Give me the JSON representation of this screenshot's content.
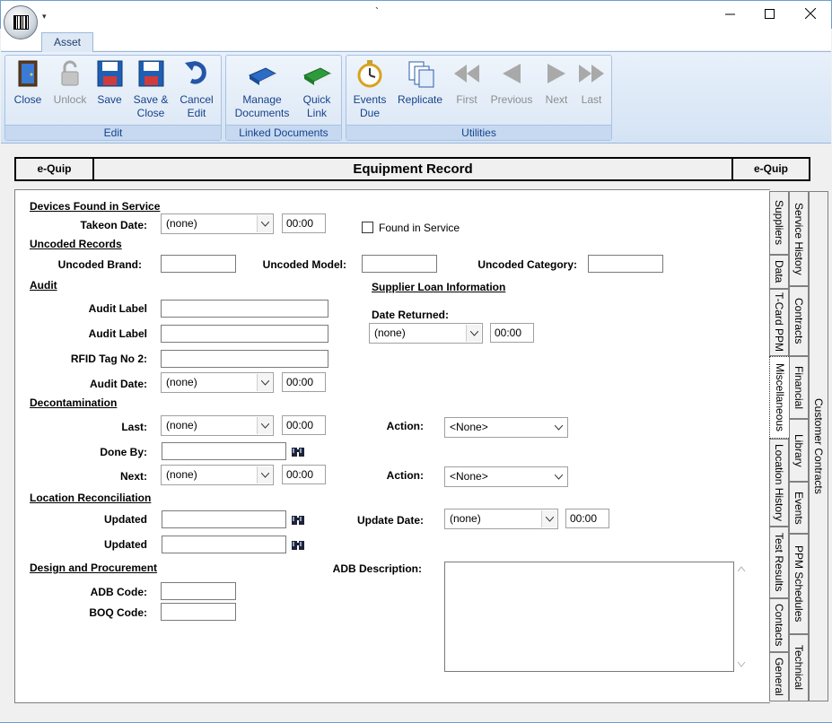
{
  "window": {
    "title": "`",
    "minimize_label": "—",
    "maximize_label": "☐",
    "close_label": "✕"
  },
  "ribbon": {
    "tabs": [
      "Asset"
    ],
    "groups": {
      "edit": {
        "label": "Edit",
        "buttons": [
          {
            "label": "Close",
            "icon": "door-icon",
            "enabled": true
          },
          {
            "label": "Unlock",
            "icon": "padlock-icon",
            "enabled": false
          },
          {
            "label": "Save",
            "icon": "floppy-disk-icon",
            "enabled": true
          },
          {
            "label": "Save &\nClose",
            "icon": "floppy-disk-icon",
            "enabled": true
          },
          {
            "label": "Cancel\nEdit",
            "icon": "undo-arrow-icon",
            "enabled": true
          }
        ]
      },
      "linked_documents": {
        "label": "Linked Documents",
        "buttons": [
          {
            "label": "Manage\nDocuments",
            "icon": "blue-book-icon",
            "enabled": true
          },
          {
            "label": "Quick\nLink",
            "icon": "green-book-icon",
            "enabled": true
          }
        ]
      },
      "utilities": {
        "label": "Utilities",
        "buttons": [
          {
            "label": "Events\nDue",
            "icon": "stopwatch-icon",
            "enabled": true
          },
          {
            "label": "Replicate",
            "icon": "copy-pages-icon",
            "enabled": true
          },
          {
            "label": "First",
            "icon": "first-arrow-icon",
            "enabled": false
          },
          {
            "label": "Previous",
            "icon": "previous-arrow-icon",
            "enabled": false
          },
          {
            "label": "Next",
            "icon": "next-arrow-icon",
            "enabled": false
          },
          {
            "label": "Last",
            "icon": "last-arrow-icon",
            "enabled": false
          }
        ]
      }
    }
  },
  "header": {
    "left": "e-Quip",
    "title": "Equipment Record",
    "right": "e-Quip"
  },
  "form": {
    "devices_found": {
      "heading": "Devices Found in Service",
      "takeon_label": "Takeon Date:",
      "takeon_value": "(none)",
      "takeon_time": "00:00",
      "found_label": "Found in Service"
    },
    "uncoded": {
      "heading": "Uncoded Records",
      "brand_label": "Uncoded Brand:",
      "model_label": "Uncoded Model:",
      "category_label": "Uncoded Category:"
    },
    "audit": {
      "heading": "Audit",
      "label1": "Audit Label",
      "label2": "Audit Label",
      "rfid_label": "RFID Tag No 2:",
      "date_label": "Audit Date:",
      "date_value": "(none)",
      "date_time": "00:00"
    },
    "supplier_loan": {
      "heading": "Supplier Loan Information",
      "returned_label": "Date Returned:",
      "returned_value": "(none)",
      "returned_time": "00:00"
    },
    "decontamination": {
      "heading": "Decontamination",
      "last_label": "Last:",
      "last_value": "(none)",
      "last_time": "00:00",
      "action1_label": "Action:",
      "action1_value": "<None>",
      "doneby_label": "Done By:",
      "next_label": "Next:",
      "next_value": "(none)",
      "next_time": "00:00",
      "action2_label": "Action:",
      "action2_value": "<None>"
    },
    "location": {
      "heading": "Location Reconciliation",
      "updated1_label": "Updated",
      "updated2_label": "Updated",
      "update_date_label": "Update Date:",
      "update_date_value": "(none)",
      "update_date_time": "00:00"
    },
    "design": {
      "heading": "Design and Procurement",
      "adb_code_label": "ADB Code:",
      "boq_code_label": "BOQ Code:",
      "adb_desc_label": "ADB Description:"
    }
  },
  "side_tabs": {
    "inner": [
      "Suppliers",
      "Data",
      "T-Card PPM",
      "Miscellaneous",
      "Location History",
      "Test Results",
      "Contacts",
      "General"
    ],
    "middle": [
      "Service History",
      "Contracts",
      "Financial",
      "Library",
      "Events",
      "PPM Schedules",
      "Technical"
    ],
    "outer": [
      "Customer Contracts"
    ],
    "selected": "Miscellaneous"
  },
  "icons": {
    "dropdown": "chevron-down-icon",
    "lookup": "binoculars-icon"
  }
}
